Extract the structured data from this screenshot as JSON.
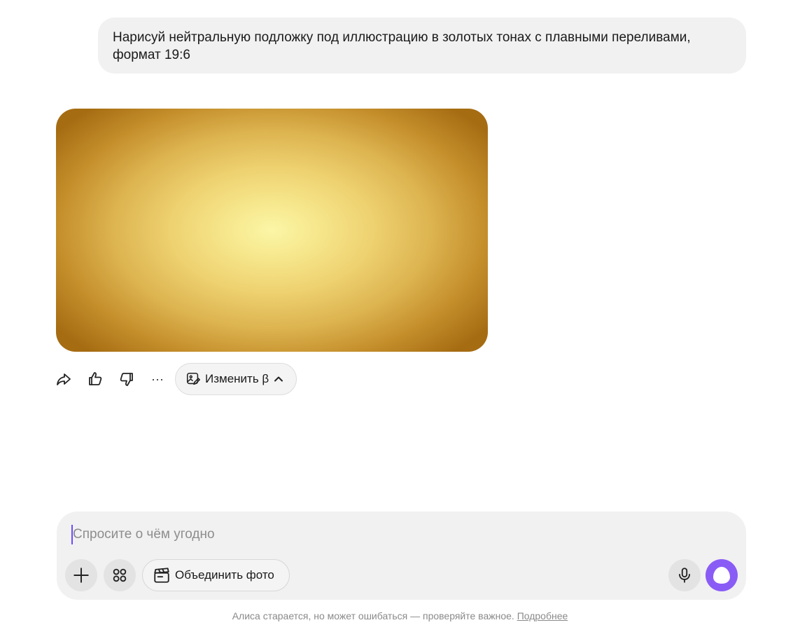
{
  "user_message": {
    "text": "Нарисуй нейтральную подложку под иллюстрацию в золотых тонах с плавными переливами, формат 19:6"
  },
  "generated_image": {
    "description_colors": [
      "#fbf6a6",
      "#eed170",
      "#c48e2b",
      "#a66c12"
    ]
  },
  "actions": {
    "share_icon": "share-arrow-icon",
    "like_icon": "thumbs-up-icon",
    "dislike_icon": "thumbs-down-icon",
    "more_label": "···",
    "edit_label": "Изменить β",
    "edit_icon": "image-edit-icon"
  },
  "composer": {
    "placeholder": "Спросите о чём угодно",
    "value": "",
    "merge_label": "Объединить фото",
    "accent_color": "#8a5cf6"
  },
  "disclaimer": {
    "text": "Алиса старается, но может ошибаться — проверяйте важное.",
    "link": "Подробнее"
  }
}
